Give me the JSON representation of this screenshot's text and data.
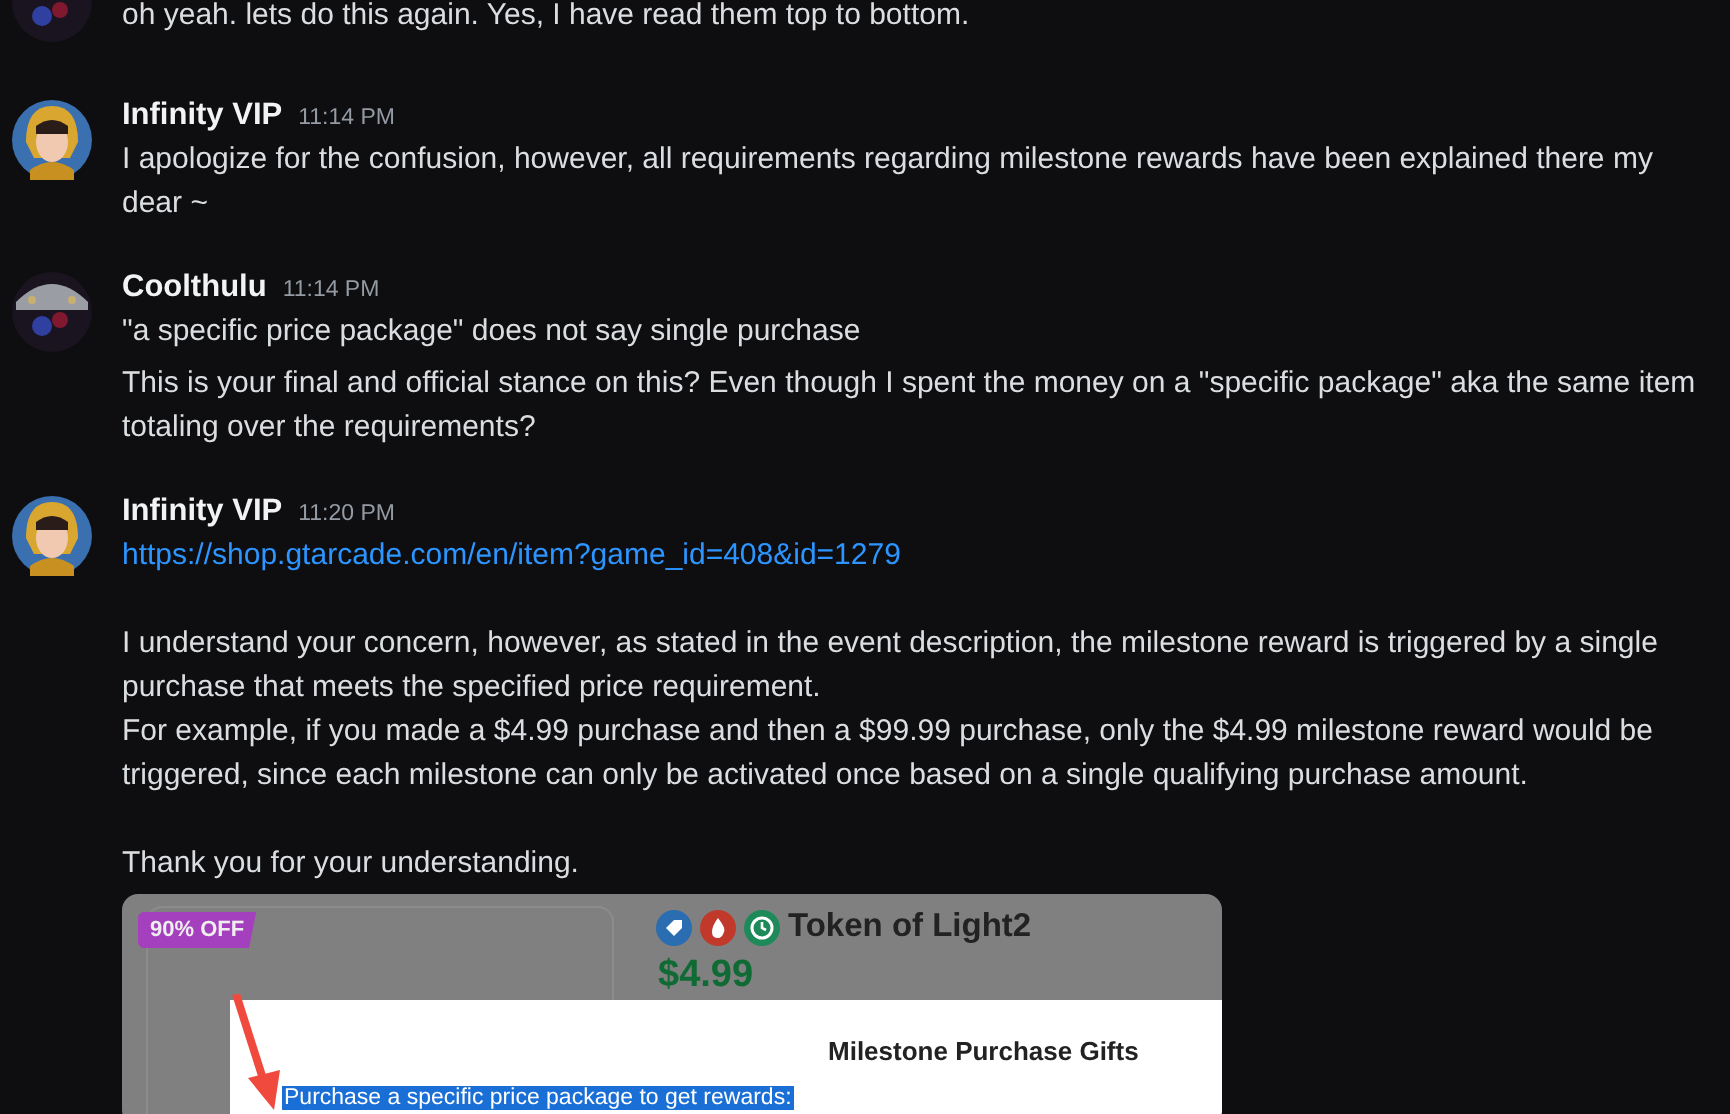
{
  "groups": [
    {
      "avatar": {
        "kind": "helmet"
      },
      "messages": [
        {
          "blocks": [
            {
              "lines": [
                {
                  "kind": "text",
                  "text": "oh yeah. lets do this again. Yes, I have read them top to bottom."
                }
              ]
            }
          ]
        }
      ]
    },
    {
      "avatar": {
        "kind": "portrait"
      },
      "author": "Infinity VIP",
      "time": "11:14 PM",
      "messages": [
        {
          "blocks": [
            {
              "lines": [
                {
                  "kind": "text",
                  "text": "I apologize for the confusion, however, all requirements regarding milestone rewards have been explained there my dear ~"
                }
              ]
            }
          ]
        }
      ]
    },
    {
      "avatar": {
        "kind": "helmet"
      },
      "author": "Coolthulu",
      "time": "11:14 PM",
      "messages": [
        {
          "blocks": [
            {
              "lines": [
                {
                  "kind": "text",
                  "text": "\"a specific price package\" does not say single purchase"
                }
              ]
            }
          ]
        },
        {
          "blocks": [
            {
              "lines": [
                {
                  "kind": "text",
                  "text": "This is your final and official stance on this? Even though I spent the money on a \"specific package\" aka the same item totaling over the requirements?"
                }
              ]
            }
          ]
        }
      ]
    },
    {
      "avatar": {
        "kind": "portrait"
      },
      "author": "Infinity VIP",
      "time": "11:20 PM",
      "messages": [
        {
          "blocks": [
            {
              "lines": [
                {
                  "kind": "link",
                  "text": "https://shop.gtarcade.com/en/item?game_id=408&id=1279"
                }
              ]
            },
            {
              "lines": [
                {
                  "kind": "text",
                  "text": "I understand your concern, however, as stated in the event description, the milestone reward is triggered by a single purchase that meets the specified price requirement."
                },
                {
                  "kind": "text",
                  "text": "For example, if you made a $4.99 purchase and then a $99.99 purchase, only the $4.99 milestone reward would be triggered, since each milestone can only be activated once based on a single qualifying purchase amount."
                }
              ]
            },
            {
              "lines": [
                {
                  "kind": "text",
                  "text": "Thank you for your understanding."
                }
              ]
            }
          ]
        }
      ],
      "attachment": {
        "kind": "screenshot",
        "badge": "90% OFF",
        "title": "Token of Light2",
        "price": "$4.99",
        "dialog_title": "Milestone Purchase Gifts",
        "dialog_text": "Purchase a specific price package to get rewards:"
      }
    }
  ]
}
